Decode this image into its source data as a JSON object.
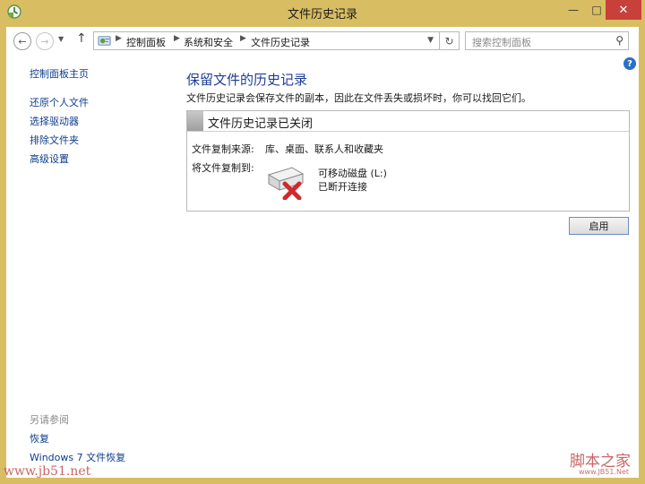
{
  "window": {
    "title": "文件历史记录",
    "app_icon": "file-history-icon",
    "minimize_glyph": "—",
    "maximize_glyph": "□",
    "close_glyph": "✕"
  },
  "navigation": {
    "back_glyph": "←",
    "forward_glyph": "→",
    "recent_glyph": "▼",
    "up_glyph": "↑",
    "refresh_glyph": "↻",
    "breadcrumbs": [
      "控制面板",
      "系统和安全",
      "文件历史记录"
    ],
    "search_placeholder": "搜索控制面板",
    "search_glyph": "⚲"
  },
  "sidebar": {
    "home_link": "控制面板主页",
    "items": [
      {
        "label": "还原个人文件"
      },
      {
        "label": "选择驱动器"
      },
      {
        "label": "排除文件夹"
      },
      {
        "label": "高级设置"
      }
    ],
    "see_also_caption": "另请参阅",
    "see_also": [
      {
        "label": "恢复"
      },
      {
        "label": "Windows 7 文件恢复"
      }
    ]
  },
  "main": {
    "help_glyph": "?",
    "heading": "保留文件的历史记录",
    "description": "文件历史记录会保存文件的副本，因此在文件丢失或损坏时，你可以找回它们。",
    "status": {
      "title": "文件历史记录已关闭",
      "source_label": "文件复制来源:",
      "source_value": "库、桌面、联系人和收藏夹",
      "target_label": "将文件复制到:",
      "drive_name": "可移动磁盘 (L:)",
      "drive_status": "已断开连接"
    },
    "enable_button": "启用"
  },
  "watermarks": {
    "left": "www.jb51.net",
    "right": "脚本之家",
    "right_sub": "www.JB51.Net"
  },
  "colors": {
    "frame": "#d8bd62",
    "close_button": "#c7403a",
    "link": "#0f3d8c",
    "heading": "#1e3e93",
    "error_x": "#d0282e",
    "watermark": "#c24a4a"
  }
}
